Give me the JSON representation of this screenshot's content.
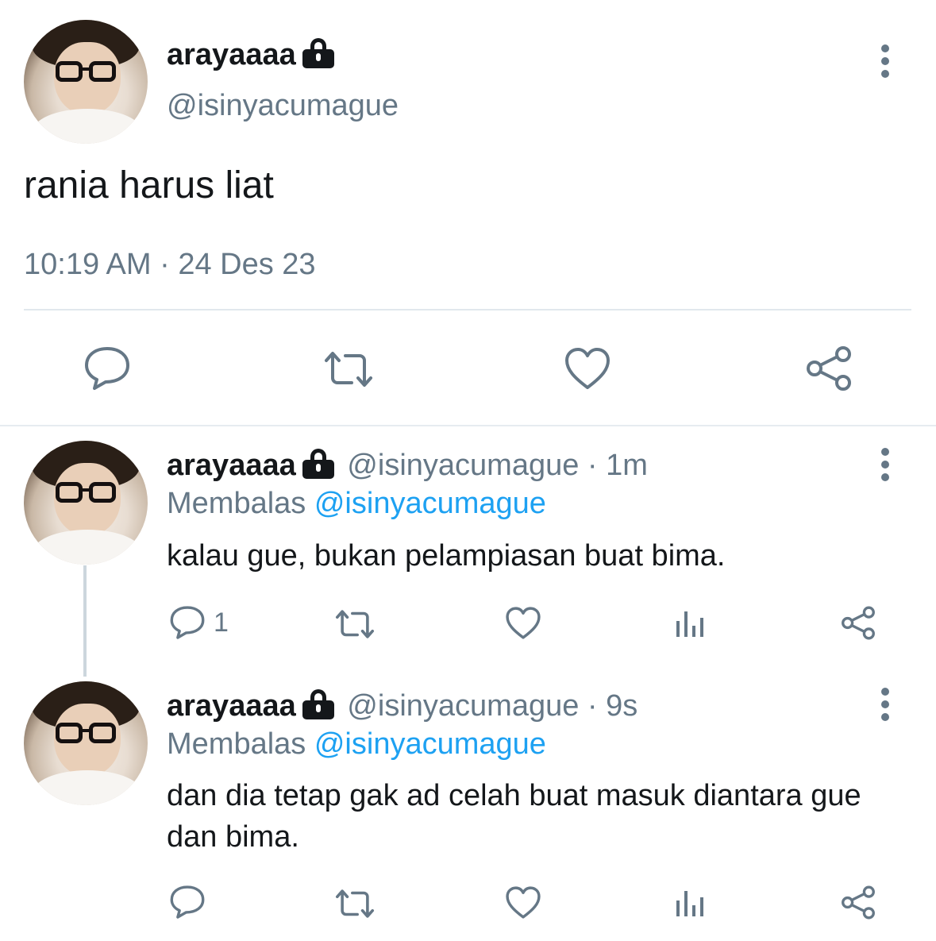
{
  "main_tweet": {
    "display_name": "arayaaaa",
    "handle": "@isinyacumague",
    "text": "rania harus liat",
    "timestamp": "10:19 AM",
    "separator": "·",
    "date": "24 Des 23",
    "icons": [
      "reply-icon",
      "retweet-icon",
      "like-icon",
      "share-icon"
    ]
  },
  "replies": [
    {
      "display_name": "arayaaaa",
      "handle": "@isinyacumague",
      "separator": "·",
      "time": "1m",
      "replying_label": "Membalas",
      "replying_to": "@isinyacumague",
      "text": "kalau gue, bukan pelampiasan buat bima.",
      "reply_count": "1"
    },
    {
      "display_name": "arayaaaa",
      "handle": "@isinyacumague",
      "separator": "·",
      "time": "9s",
      "replying_label": "Membalas",
      "replying_to": "@isinyacumague",
      "text": "dan dia tetap gak ad celah buat masuk diantara gue dan bima.",
      "reply_count": ""
    }
  ],
  "colors": {
    "text": "#14171a",
    "muted": "#657786",
    "link": "#1da1f2",
    "divider": "#e1e8ed"
  }
}
